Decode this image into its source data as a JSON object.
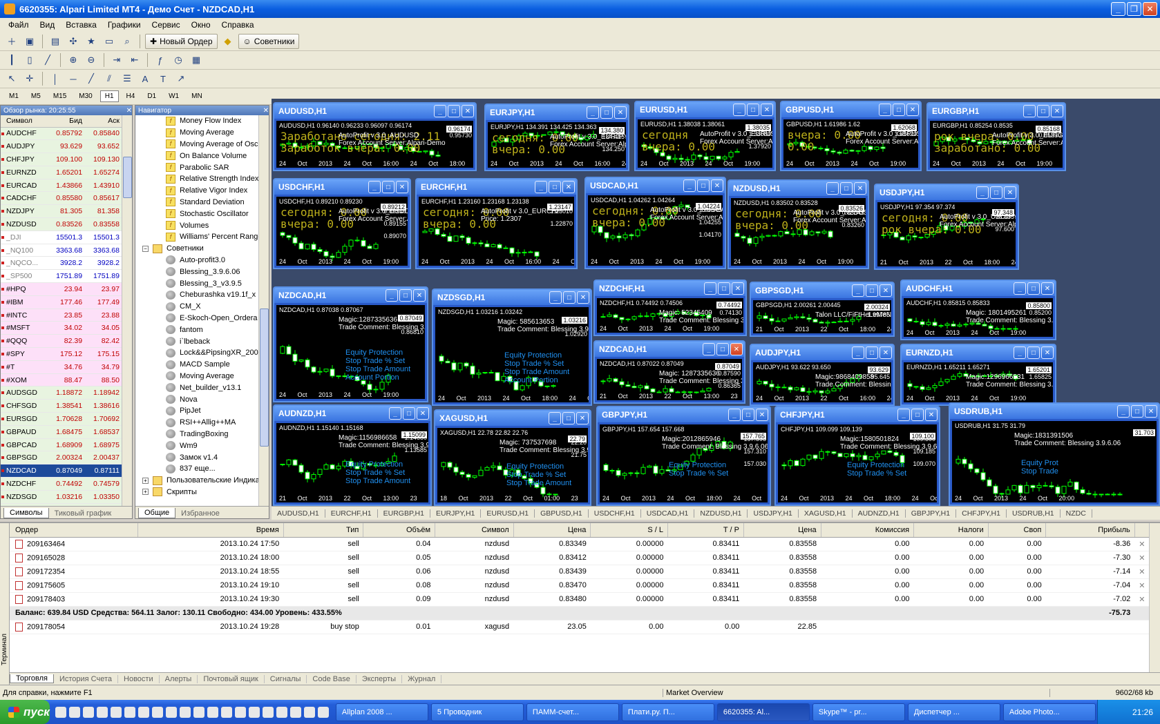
{
  "window": {
    "title": "6620355: Alpari Limited MT4 - Демо Счет - NZDCAD,H1"
  },
  "menu": [
    "Файл",
    "Вид",
    "Вставка",
    "Графики",
    "Сервис",
    "Окно",
    "Справка"
  ],
  "toolbar": {
    "new_order": "Новый Ордер",
    "experts": "Советники"
  },
  "timeframes": [
    "M1",
    "M5",
    "M15",
    "M30",
    "H1",
    "H4",
    "D1",
    "W1",
    "MN"
  ],
  "market_watch": {
    "title": "Обзор рынка: 20:25:55",
    "headers": [
      "Символ",
      "Бид",
      "Аск"
    ],
    "rows": [
      {
        "s": "AUDCHF",
        "b": "0.85792",
        "a": "0.85840",
        "c": "green"
      },
      {
        "s": "AUDJPY",
        "b": "93.629",
        "a": "93.652",
        "c": "green"
      },
      {
        "s": "CHFJPY",
        "b": "109.100",
        "a": "109.130",
        "c": "green"
      },
      {
        "s": "EURNZD",
        "b": "1.65201",
        "a": "1.65274",
        "c": "green"
      },
      {
        "s": "EURCAD",
        "b": "1.43866",
        "a": "1.43910",
        "c": "green"
      },
      {
        "s": "CADCHF",
        "b": "0.85580",
        "a": "0.85617",
        "c": "green"
      },
      {
        "s": "NZDJPY",
        "b": "81.305",
        "a": "81.358",
        "c": "green"
      },
      {
        "s": "NZDUSD",
        "b": "0.83526",
        "a": "0.83558",
        "c": "green"
      },
      {
        "s": "_DJI",
        "b": "15501.3",
        "a": "15501.3",
        "c": "grey"
      },
      {
        "s": "_NQ100",
        "b": "3363.68",
        "a": "3363.68",
        "c": "grey"
      },
      {
        "s": "_NQCO...",
        "b": "3928.2",
        "a": "3928.2",
        "c": "grey"
      },
      {
        "s": "_SP500",
        "b": "1751.89",
        "a": "1751.89",
        "c": "grey"
      },
      {
        "s": "#HPQ",
        "b": "23.94",
        "a": "23.97",
        "c": "pink"
      },
      {
        "s": "#IBM",
        "b": "177.46",
        "a": "177.49",
        "c": "pink"
      },
      {
        "s": "#INTC",
        "b": "23.85",
        "a": "23.88",
        "c": "pink"
      },
      {
        "s": "#MSFT",
        "b": "34.02",
        "a": "34.05",
        "c": "pink"
      },
      {
        "s": "#QQQ",
        "b": "82.39",
        "a": "82.42",
        "c": "pink"
      },
      {
        "s": "#SPY",
        "b": "175.12",
        "a": "175.15",
        "c": "pink"
      },
      {
        "s": "#T",
        "b": "34.76",
        "a": "34.79",
        "c": "pink"
      },
      {
        "s": "#XOM",
        "b": "88.47",
        "a": "88.50",
        "c": "pink"
      },
      {
        "s": "AUDSGD",
        "b": "1.18872",
        "a": "1.18942",
        "c": "green"
      },
      {
        "s": "CHFSGD",
        "b": "1.38541",
        "a": "1.38616",
        "c": "green"
      },
      {
        "s": "EURSGD",
        "b": "1.70628",
        "a": "1.70692",
        "c": "green"
      },
      {
        "s": "GBPAUD",
        "b": "1.68475",
        "a": "1.68537",
        "c": "green"
      },
      {
        "s": "GBPCAD",
        "b": "1.68909",
        "a": "1.68975",
        "c": "green"
      },
      {
        "s": "GBPSGD",
        "b": "2.00324",
        "a": "2.00437",
        "c": "green"
      },
      {
        "s": "NZDCAD",
        "b": "0.87049",
        "a": "0.87111",
        "c": "sel"
      },
      {
        "s": "NZDCHF",
        "b": "0.74492",
        "a": "0.74579",
        "c": "green"
      },
      {
        "s": "NZDSGD",
        "b": "1.03216",
        "a": "1.03350",
        "c": "green"
      },
      {
        "s": "SGDJPY",
        "b": "78.718",
        "a": "78.774",
        "c": "green"
      }
    ],
    "tabs": [
      "Символы",
      "Тиковый график"
    ]
  },
  "navigator": {
    "title": "Навигатор",
    "indicators": [
      "Money Flow Index",
      "Moving Average",
      "Moving Average of Oscill",
      "On Balance Volume",
      "Parabolic SAR",
      "Relative Strength Index",
      "Relative Vigor Index",
      "Standard Deviation",
      "Stochastic Oscillator",
      "Volumes",
      "Williams' Percent Range"
    ],
    "experts_group": "Советники",
    "experts": [
      "Auto-profit3.0",
      "Blessing_3.9.6.06",
      "Blessing_3_v3.9.5",
      "Cheburashka v19.1f_x",
      "CM_X",
      "E-Skoch-Open_Ordera",
      "fantom",
      "i`lbeback",
      "Lock&&PipsingXR_2009_",
      "MACD Sample",
      "Moving Average",
      "Net_builder_v13.1",
      "Nova",
      "PipJet",
      "RSI++Allig++MA",
      "TradingBoxing",
      "Wm9",
      "Замок v1.4",
      "837 еще..."
    ],
    "custom_indicators": "Пользовательские Индикат",
    "scripts": "Скрипты",
    "tabs": [
      "Общие",
      "Избранное"
    ]
  },
  "charts": [
    {
      "t": "AUDUSD,H1",
      "h": "AUDUSD,H1 0.96140 0.96233 0.96097 0.96174",
      "d": "24 Oct 2013  24 Oct 16:00  24 Oct 18:00  24 Oct 20:00",
      "tag": "0.96174",
      "p": [
        "",
        "",
        "0.95730"
      ],
      "ov": [
        "Заработано сегодня: 2.11",
        "Заработок вчера: 0.00"
      ],
      "info": [
        "AutoProfit v 3.0_AUDUSD",
        "Forex Account Server:Alpari-Demo"
      ]
    },
    {
      "t": "EURJPY,H1",
      "h": "EURJPY,H1 134.391 134.425 134.363",
      "d": "24 Oct 2013  24 Oct 16:00  24 Oct 18:00",
      "tag": "134.380",
      "p": [
        "134.415",
        "",
        "134.250"
      ],
      "ov": [
        "сегодня: 0.00",
        "вчера: 0.00"
      ],
      "info": [
        "AutoProfit v 3.0_EURJPY",
        "Forex Account Server:Alpari-Demo"
      ]
    },
    {
      "t": "EURUSD,H1",
      "h": "EURUSD,H1 1.38038 1.38061",
      "d": "24 Oct 2013  24 Oct 19:00",
      "tag": "1.38035",
      "p": [
        "1.38080",
        "",
        "1.37920"
      ],
      "ov": [
        "сегодня",
        "вчера: 0.00"
      ],
      "info": [
        "AutoProfit v 3.0_EURUSD",
        "Forex Account Server:Alpari-D"
      ]
    },
    {
      "t": "GBPUSD,H1",
      "h": "GBPUSD,H1 1.61986 1.62",
      "d": "24 Oct 2013  24 Oct 19:00",
      "tag": "1.62068",
      "p": [
        "",
        "1.61620",
        ""
      ],
      "ov": [
        "вчера: 0.00",
        "0.00"
      ],
      "info": [
        "AutoProfit v 3.0_GBPUSD",
        "Forex Account Server:Alpari-D"
      ]
    },
    {
      "t": "EURGBP,H1",
      "h": "EURGBP,H1 0.85254 0.8535",
      "d": "24 Oct 2013  24 Oct 19:00",
      "tag": "0.85168",
      "p": [
        "",
        "0.85330",
        ""
      ],
      "ov": [
        "рок вчера: 0.00",
        "заработано: 0.00"
      ],
      "info": [
        "AutoProfit v 3.0_EURGBP",
        "Forex Account Server:Alpari-D"
      ]
    },
    {
      "t": "USDCHF,H1",
      "h": "USDCHF,H1 0.89210 0.89230",
      "d": "24 Oct 2013  24 Oct 19:00",
      "tag": "0.89212",
      "p": [
        "0.89240",
        "0.89155",
        "0.89070"
      ],
      "ov": [
        "сегодня: 0.00",
        "вчера: 0.00"
      ],
      "info": [
        "AutoProfit v 3.0_USDCHF",
        "Forex Account Server:Alpari-D"
      ]
    },
    {
      "t": "EURCHF,H1",
      "h": "EURCHF,H1 1.23160 1.23168 1.23138",
      "d": "24 Oct 2013  24 Oct 16:00  24 Oct 18:00  24 Oct 20:00",
      "tag": "1.23147",
      "p": [
        "",
        "1.23010",
        "1.22870"
      ],
      "ov": [
        "сегодня: 0.00",
        "вчера: 0.00"
      ],
      "info": [
        "AutoProfit v 3.0_EURCHF",
        "Price: 1.2307"
      ]
    },
    {
      "t": "USDCAD,H1",
      "h": "USDCAD,H1 1.04262 1.04264",
      "d": "24 Oct 2013  24 Oct 19:00",
      "tag": "1.04224",
      "p": [
        "1.04340",
        "1.04255",
        "1.04170"
      ],
      "ov": [
        "сегодня: 0.00",
        "вчера: 0.00"
      ],
      "info": [
        "AutoProfit v 3.0_USDCAD",
        "Forex Account Server:Alpari-D"
      ]
    },
    {
      "t": "NZDUSD,H1",
      "h": "NZDUSD,H1 0.83502 0.83528",
      "d": "24 Oct 2013  24 Oct 19:00",
      "tag": "0.83526",
      "p": [
        "",
        "0.83345",
        "0.83260"
      ],
      "ov": [
        "сегодня: 0.00",
        "вчера: 0.00"
      ],
      "info": [
        "AutoProfit v 3.0_NZDUSD",
        "Forex Account Server:Alpari-D"
      ]
    },
    {
      "t": "USDJPY,H1",
      "h": "USDJPY,H1 97.354 97.374",
      "d": "21 Oct 2013  22 Oct 18:00  24 Oct 02:00",
      "tag": "97.348",
      "p": [
        "98.335",
        "97.600",
        ""
      ],
      "ov": [
        "сегодня: 0.00",
        "рок вчера: 0.00"
      ],
      "info": [
        "AutoProfit v 3.0_USDJPY",
        "Forex Account Server:Alpari-D"
      ]
    },
    {
      "t": "NZDCAD,H1",
      "h": "NZDCAD,H1 0.87038 0.87067",
      "d": "24 Oct 2013  24 Oct 19:00",
      "tag": "0.87049",
      "p": [
        "",
        "0.86920",
        "0.86810"
      ],
      "ov": [],
      "info": [
        "Magic:1287335636",
        "Trade Comment: Blessing 3.9.6.06"
      ],
      "blue": [
        "Equity Protection",
        "Stop Trade % Set",
        "Stop Trade Amount",
        "Account Portion"
      ]
    },
    {
      "t": "NZDSGD,H1",
      "h": "NZDSGD,H1 1.03216 1.03242",
      "d": "24 Oct 2013  24 Oct 18:00  24 Oct 20:00",
      "tag": "1.03216",
      "p": [
        "",
        "1.03130",
        "1.02920"
      ],
      "ov": [],
      "info": [
        "Magic: 585613653",
        "Trade Comment: Blessing 3.9.6.06"
      ],
      "blue": [
        "Equity Protection",
        "Stop Trade % Set",
        "Stop Trade Amount",
        "Account Portion"
      ]
    },
    {
      "t": "NZDCHF,H1",
      "h": "NZDCHF,H1 0.74492 0.74506",
      "d": "24 Oct 2013  24 Oct 19:00",
      "tag": "0.74492",
      "p": [
        "",
        "0.74130",
        ""
      ],
      "ov": [],
      "info": [
        "Magic: 52345409",
        "Trade Comment: Blessing 3.9.6.06"
      ]
    },
    {
      "t": "GBPSGD,H1",
      "h": "GBPSGD,H1 2.00261 2.00445",
      "d": "21 Oct 2013  22 Oct 18:00  24 Oct 02:00",
      "tag": "2.00324",
      "p": [
        "",
        "1.99785",
        ""
      ],
      "ov": [],
      "info": [
        "Talon LLC/FiFtHeLeMeNt"
      ]
    },
    {
      "t": "AUDCHF,H1",
      "h": "AUDCHF,H1 0.85815 0.85833",
      "d": "24 Oct 2013  24 Oct 19:00",
      "tag": "0.85800",
      "p": [
        "",
        "0.85200",
        ""
      ],
      "ov": [],
      "info": [
        "Magic: 1801495261",
        "Trade Comment: Blessing 3.9.6.06"
      ]
    },
    {
      "t": "NZDCAD,H1",
      "h": "NZDCAD,H1 0.87022 0.87049",
      "d": "21 Oct 2013  22 Oct 13:00  23 Oct 21:00",
      "tag": "0.87049",
      "p": [
        "0.87590",
        "",
        "0.86365"
      ],
      "ov": [],
      "info": [
        "Magic: 1287335636",
        "Trade Comment: Blessing 3.9.6.06"
      ]
    },
    {
      "t": "AUDJPY,H1",
      "h": "AUDJPY,H1 93.622 93.650",
      "d": "24 Oct 2013  22 Oct 16:00  24 Oct 00:00",
      "tag": "93.629",
      "p": [
        "95.645",
        "",
        ""
      ],
      "ov": [],
      "info": [
        "Magic:9868409858",
        "Trade Comment: Blessing 3.9.6.06"
      ]
    },
    {
      "t": "EURNZD,H1",
      "h": "EURNZD,H1 1.65211 1.65271",
      "d": "24 Oct 2013  24 Oct 19:00",
      "tag": "1.65201",
      "p": [
        "1.65825",
        "",
        ""
      ],
      "ov": [],
      "info": [
        "Magic:1296966531",
        "Trade Comment: Blessing 3.9.6.06"
      ]
    },
    {
      "t": "AUDNZD,H1",
      "h": "AUDNZD,H1 1.15140 1.15168",
      "d": "21 Oct 2013  22 Oct 13:00  23 Oct 21:00",
      "tag": "1.15099",
      "p": [
        "",
        "1.14680",
        "1.13585"
      ],
      "ov": [],
      "info": [
        "Magic:1156986658",
        "Trade Comment: Blessing 3.9.6.06"
      ],
      "blue": [
        "Equity Protection",
        "Stop Trade % Set",
        "Stop Trade Amount"
      ]
    },
    {
      "t": "XAGUSD,H1",
      "h": "XAGUSD,H1 22.78 22.82 22.76",
      "d": "18 Oct 2013  22 Oct 01:00  23 Oct 10:00",
      "tag": "22.79",
      "p": [
        "",
        "22.20",
        "21.75"
      ],
      "ov": [],
      "info": [
        "Magic: 737537698",
        "Trade Comment: Blessing 3.9.6.06"
      ],
      "blue": [
        "Equity Protection",
        "Stop Trade % Set",
        "Stop Trade Amount"
      ]
    },
    {
      "t": "GBPJPY,H1",
      "h": "GBPJPY,H1 157.654 157.668",
      "d": "24 Oct 2013  24 Oct 18:00  24 Oct 20:00",
      "tag": "157.765",
      "p": [
        "157.595",
        "157.310",
        "157.030"
      ],
      "ov": [],
      "info": [
        "Magic:2012865946",
        "Trade Comment: Blessing 3.9.6.06"
      ],
      "blue": [
        "Equity Protection",
        "Stop Trade % Set"
      ]
    },
    {
      "t": "CHFJPY,H1",
      "h": "CHFJPY,H1 109.099 109.139",
      "d": "24 Oct 2013  24 Oct 18:00  24 Oct 20:00",
      "tag": "109.100",
      "p": [
        "109.300",
        "109.185",
        "109.070"
      ],
      "ov": [],
      "info": [
        "Magic:1580501824",
        "Trade Comment: Blessing 3.9.6.06"
      ],
      "blue": [
        "Equity Protection",
        "Stop Trade % Set"
      ]
    },
    {
      "t": "USDRUB,H1",
      "h": "USDRUB,H1 31.75 31.79",
      "d": "24 Oct 2013  24 Oct 20:00",
      "tag": "31.703",
      "p": [
        "",
        "",
        ""
      ],
      "ov": [],
      "info": [
        "Magic:1831391506",
        "Trade Comment: Blessing 3.9.6.06"
      ],
      "blue": [
        "Equity Prot",
        "Stop Trade"
      ]
    }
  ],
  "chart_tabs": [
    "AUDUSD,H1",
    "EURCHF,H1",
    "EURGBP,H1",
    "EURJPY,H1",
    "EURUSD,H1",
    "GBPUSD,H1",
    "USDCHF,H1",
    "USDCAD,H1",
    "NZDUSD,H1",
    "USDJPY,H1",
    "XAGUSD,H1",
    "AUDNZD,H1",
    "GBPJPY,H1",
    "CHFJPY,H1",
    "USDRUB,H1",
    "NZDC"
  ],
  "terminal": {
    "side_label": "Терминал",
    "headers": [
      "Ордер",
      "Время",
      "Тип",
      "Объём",
      "Символ",
      "Цена",
      "S / L",
      "T / P",
      "Цена",
      "Комиссия",
      "Налоги",
      "Своп",
      "Прибыль"
    ],
    "rows": [
      [
        "209163464",
        "2013.10.24 17:50",
        "sell",
        "0.04",
        "nzdusd",
        "0.83349",
        "0.00000",
        "0.83411",
        "0.83558",
        "0.00",
        "0.00",
        "0.00",
        "-8.36"
      ],
      [
        "209165028",
        "2013.10.24 18:00",
        "sell",
        "0.05",
        "nzdusd",
        "0.83412",
        "0.00000",
        "0.83411",
        "0.83558",
        "0.00",
        "0.00",
        "0.00",
        "-7.30"
      ],
      [
        "209172354",
        "2013.10.24 18:55",
        "sell",
        "0.06",
        "nzdusd",
        "0.83439",
        "0.00000",
        "0.83411",
        "0.83558",
        "0.00",
        "0.00",
        "0.00",
        "-7.14"
      ],
      [
        "209175605",
        "2013.10.24 19:10",
        "sell",
        "0.08",
        "nzdusd",
        "0.83470",
        "0.00000",
        "0.83411",
        "0.83558",
        "0.00",
        "0.00",
        "0.00",
        "-7.04"
      ],
      [
        "209178403",
        "2013.10.24 19:30",
        "sell",
        "0.09",
        "nzdusd",
        "0.83480",
        "0.00000",
        "0.83411",
        "0.83558",
        "0.00",
        "0.00",
        "0.00",
        "-7.02"
      ]
    ],
    "balance": "Баланс: 639.84 USD  Средства: 564.11  Залог: 130.11  Свободно: 434.00  Уровень: 433.55%",
    "balance_profit": "-75.73",
    "pending": [
      "209178054",
      "2013.10.24 19:28",
      "buy stop",
      "0.01",
      "xagusd",
      "23.05",
      "0.00",
      "0.00",
      "22.85",
      "",
      "",
      "",
      ""
    ],
    "tabs": [
      "Торговля",
      "История Счета",
      "Новости",
      "Алерты",
      "Почтовый ящик",
      "Сигналы",
      "Code Base",
      "Эксперты",
      "Журнал"
    ]
  },
  "status": {
    "help": "Для справки, нажмите F1",
    "profile": "Market Overview",
    "traffic": "9602/68 kb"
  },
  "taskbar": {
    "start": "пуск",
    "tasks": [
      "Allplan 2008 ...",
      "5 Проводник",
      "ПАММ-счет...",
      "Плати.ру. П...",
      "6620355: Al...",
      "Skype™ - pr...",
      "Диспетчер ...",
      "Adobe Photo..."
    ],
    "time": "21:26"
  }
}
